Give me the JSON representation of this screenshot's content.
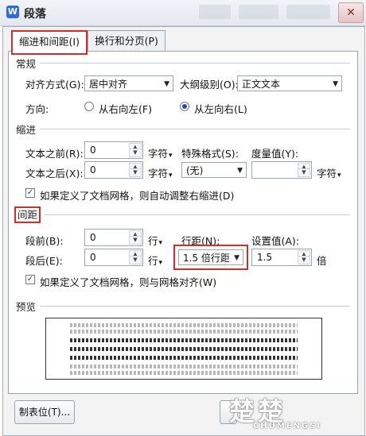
{
  "window": {
    "title": "段落",
    "app_icon": "W",
    "close_glyph": "✕"
  },
  "tabs": [
    {
      "label": "缩进和间距(I)"
    },
    {
      "label": "换行和分页(P)"
    }
  ],
  "general": {
    "section": "常规",
    "alignment_label": "对齐方式(G):",
    "alignment_value": "居中对齐",
    "outline_label": "大纲级别(O):",
    "outline_value": "正文文本",
    "direction_label": "方向:",
    "direction_options": [
      "从右向左(F)",
      "从左向右(L)"
    ],
    "direction_selected": "从左向右(L)"
  },
  "indent": {
    "section": "缩进",
    "before_label": "文本之前(R):",
    "before_value": "0",
    "before_unit": "字符",
    "after_label": "文本之后(X):",
    "after_value": "0",
    "after_unit": "字符",
    "special_label": "特殊格式(S):",
    "special_value": "(无)",
    "measure_label": "度量值(Y):",
    "measure_value": "",
    "measure_unit": "字符",
    "grid_check_label": "如果定义了文档网格，则自动调整右缩进(D)",
    "grid_checked": true
  },
  "spacing": {
    "section": "间距",
    "before_label": "段前(B):",
    "before_value": "0",
    "before_unit": "行",
    "after_label": "段后(E):",
    "after_value": "0",
    "after_unit": "行",
    "line_label": "行距(N):",
    "line_value": "1.5 倍行距",
    "setting_label": "设置值(A):",
    "setting_value": "1.5",
    "setting_unit": "倍",
    "grid_check_label": "如果定义了文档网格，则与网格对齐(W)",
    "grid_checked": true
  },
  "preview": {
    "section": "预览"
  },
  "footer": {
    "tabs_button": "制表位(T)..."
  },
  "watermark": {
    "text": "楚楚",
    "sub": "CHUMENGSI"
  },
  "colors": {
    "highlight": "#d52b2b",
    "accent": "#1d4fa8"
  }
}
